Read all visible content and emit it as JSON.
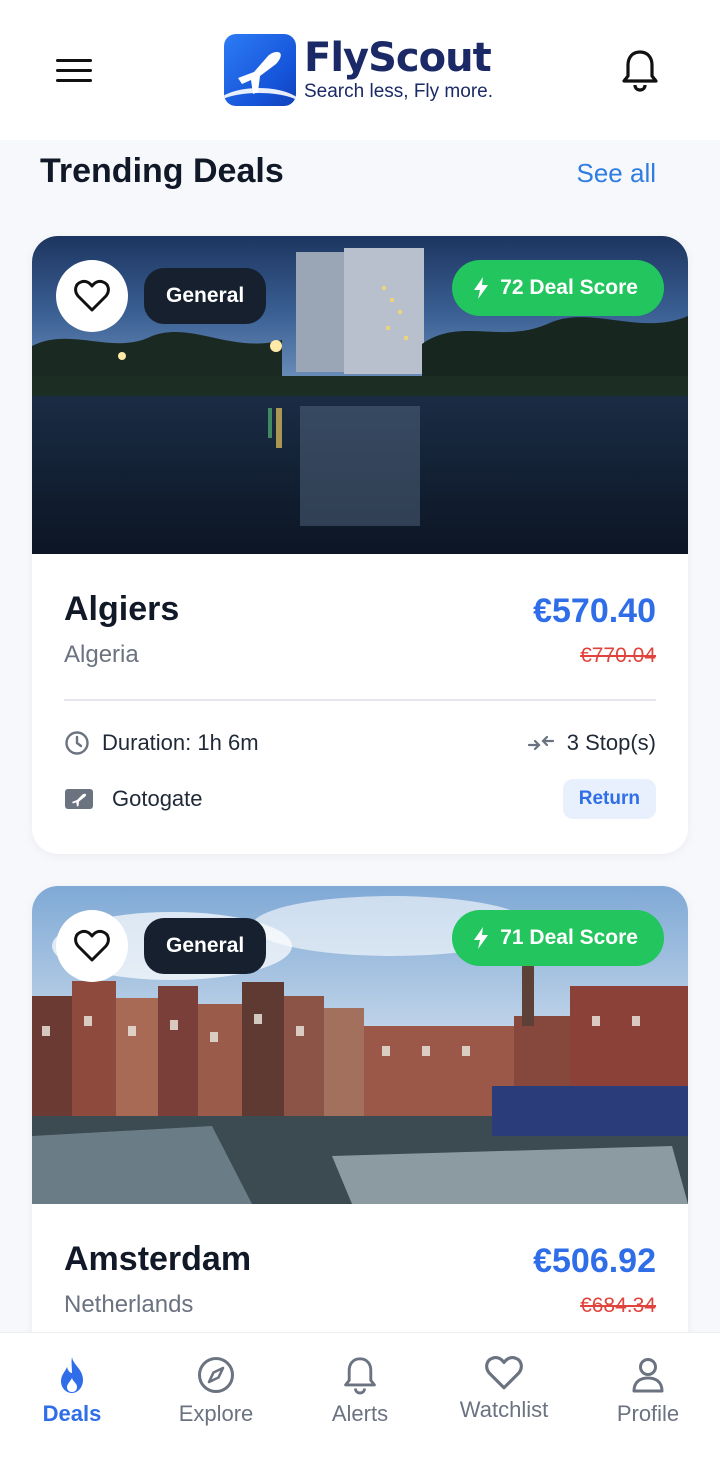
{
  "header": {
    "brand_name": "FlyScout",
    "brand_tagline": "Search less, Fly more.",
    "menu_icon": "hamburger-icon",
    "notification_icon": "bell-icon"
  },
  "section": {
    "title": "Trending Deals",
    "see_all_label": "See all"
  },
  "deals": [
    {
      "category": "General",
      "deal_score_label": "72 Deal Score",
      "city": "Algiers",
      "country": "Algeria",
      "price": "€570.40",
      "original_price": "€770.04",
      "duration": "Duration: 1h 6m",
      "stops": "3 Stop(s)",
      "provider": "Gotogate",
      "trip_type": "Return"
    },
    {
      "category": "General",
      "deal_score_label": "71 Deal Score",
      "city": "Amsterdam",
      "country": "Netherlands",
      "price": "€506.92",
      "original_price": "€684.34"
    }
  ],
  "nav": {
    "items": [
      {
        "label": "Deals",
        "icon": "flame-icon",
        "active": true
      },
      {
        "label": "Explore",
        "icon": "compass-icon",
        "active": false
      },
      {
        "label": "Alerts",
        "icon": "bell-icon",
        "active": false
      },
      {
        "label": "Watchlist",
        "icon": "heart-icon",
        "active": false
      },
      {
        "label": "Profile",
        "icon": "user-icon",
        "active": false
      }
    ]
  },
  "colors": {
    "accent": "#2f6ee8",
    "deal_score": "#22c55e",
    "original_price": "#e0433b",
    "tag_bg": "#16202e"
  }
}
